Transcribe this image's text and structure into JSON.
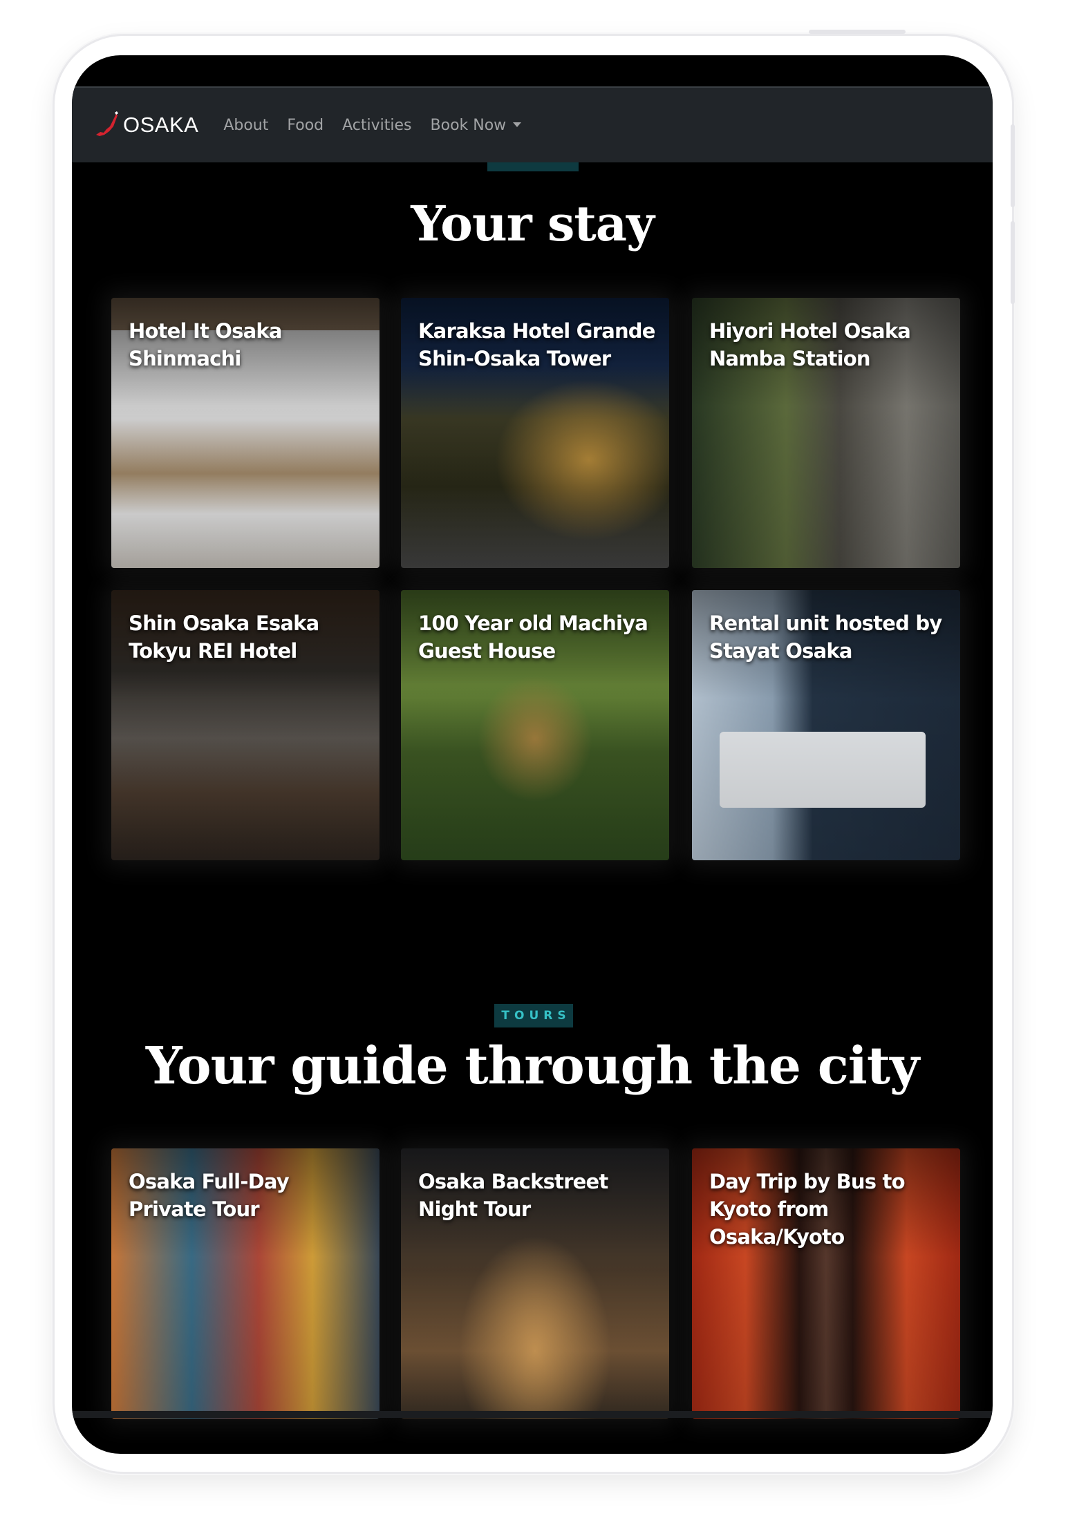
{
  "navbar": {
    "brand": "OSAKA",
    "links": [
      "About",
      "Food",
      "Activities",
      "Book Now"
    ]
  },
  "hotels": {
    "title": "Your stay",
    "cards": [
      {
        "title": "Hotel It Osaka Shinmachi"
      },
      {
        "title": "Karaksa Hotel Grande Shin-Osaka Tower"
      },
      {
        "title": "Hiyori Hotel Osaka Namba Station"
      },
      {
        "title": "Shin Osaka Esaka Tokyu REI Hotel"
      },
      {
        "title": "100 Year old Machiya Guest House"
      },
      {
        "title": "Rental unit hosted by Stayat Osaka"
      }
    ]
  },
  "tours": {
    "label": "TOURS",
    "title": "Your guide through the city",
    "cards": [
      {
        "title": "Osaka Full-Day Private Tour"
      },
      {
        "title": "Osaka Backstreet Night Tour"
      },
      {
        "title": "Day Trip by Bus to Kyoto from Osaka/Kyoto"
      }
    ]
  },
  "colors": {
    "navbar_bg": "#212529",
    "page_bg": "#000000",
    "accent_teal": "#36c1c6",
    "badge_bg": "#0d3a40"
  }
}
